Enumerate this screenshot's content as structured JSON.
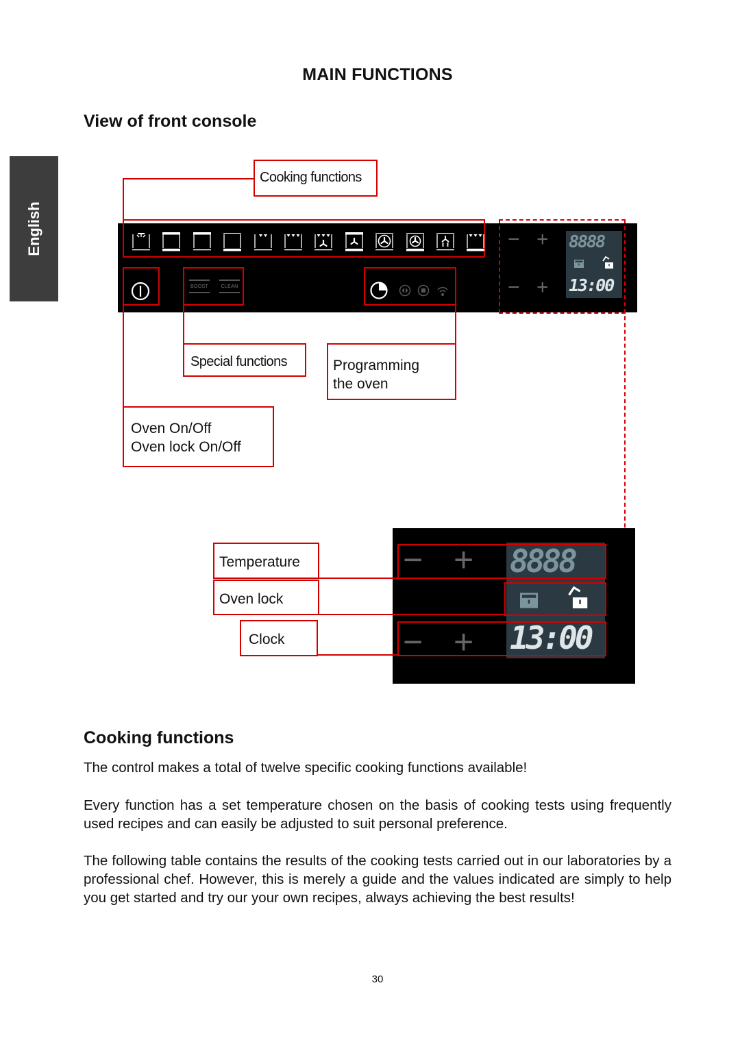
{
  "page": {
    "title": "MAIN FUNCTIONS",
    "language_tab": "English",
    "page_number": "30"
  },
  "console_section": {
    "heading": "View of front console",
    "callouts": {
      "cooking_functions": "Cooking functions",
      "special_functions": "Special functions",
      "programming_line1": "Programming",
      "programming_line2": "the oven",
      "onoff_line1": "Oven On/Off",
      "onoff_line2": "Oven lock On/Off"
    },
    "panel": {
      "cooking_function_icons": [
        "lamp-icon",
        "top-bottom-heat-icon",
        "top-heat-icon",
        "bottom-heat-icon",
        "small-grill-icon",
        "large-grill-icon",
        "fan-grill-icon",
        "fan-top-bottom-icon",
        "hot-air-icon",
        "hot-air-bottom-icon",
        "defrost-icon",
        "grill-icon"
      ],
      "boost_label": "BOOST",
      "clean_label": "CLEAN",
      "temp_display": "8888",
      "clock_display": "13:00",
      "minus_symbol": "−",
      "plus_symbol": "+"
    }
  },
  "detail_section": {
    "callouts": {
      "temperature": "Temperature",
      "oven_lock": "Oven lock",
      "clock": "Clock"
    },
    "temp_display": "8888",
    "clock_display": "13:00"
  },
  "cooking_section": {
    "heading": "Cooking functions",
    "paragraphs": [
      "The control makes a total of twelve specific cooking functions available!",
      "Every function has a set temperature chosen on the basis of cooking tests using frequently used recipes and can easily be adjusted to suit personal preference.",
      "The following table contains the results of the cooking tests carried out in our laboratories by a professional chef. However, this is merely a guide and the values indicated are simply to help you get started and try our your own recipes, always achieving the best results!"
    ]
  },
  "colors": {
    "callout_red": "#d40000",
    "lcd_background": "#2b3942",
    "lcd_segment": "#7c949c",
    "language_tab": "#3d3d3d"
  }
}
